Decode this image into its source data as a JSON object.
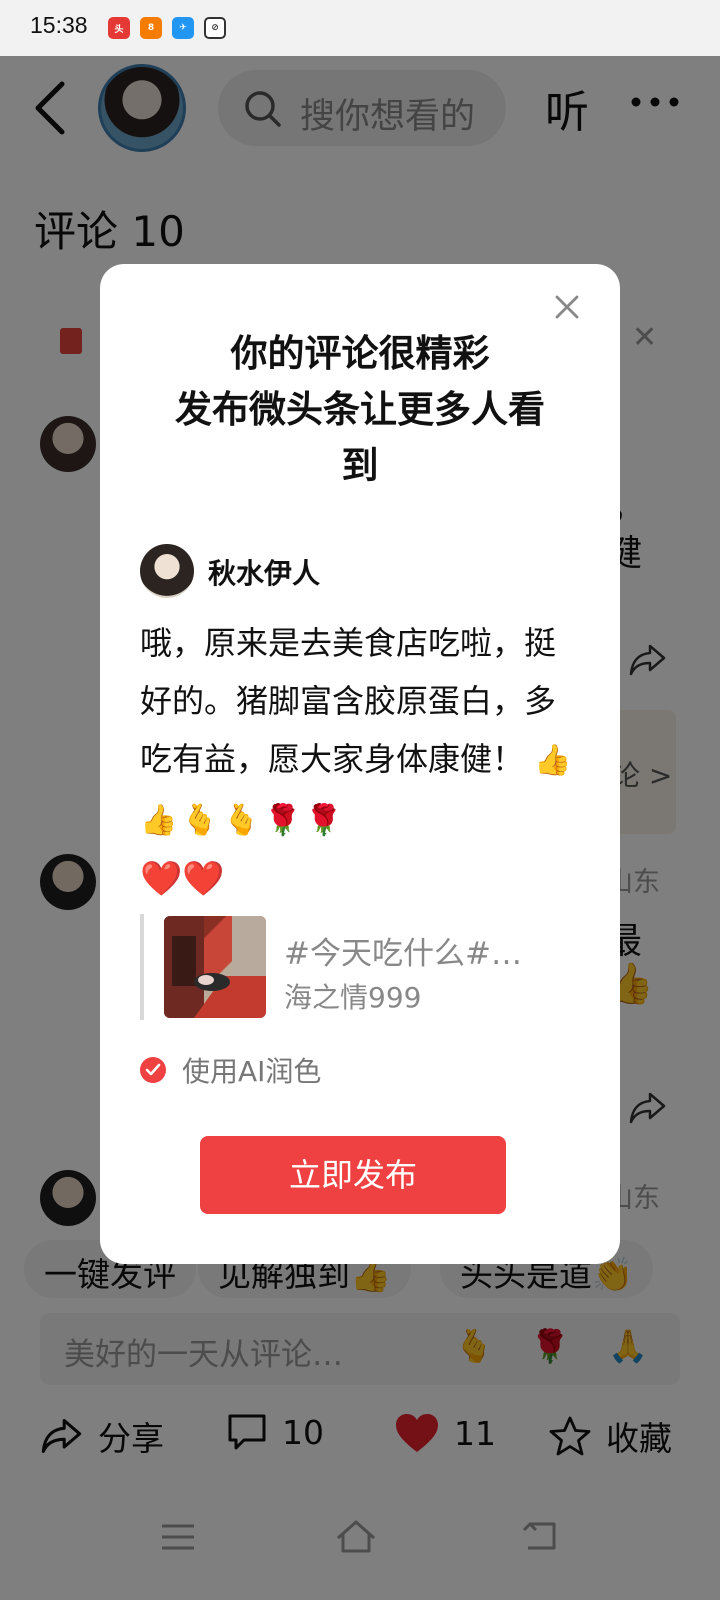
{
  "status_bar": {
    "time": "15:38",
    "icons": [
      "toutiao-app-icon",
      "notification-app-icon",
      "telegram-icon",
      "browser-icon"
    ]
  },
  "header": {
    "search_placeholder": "搜你想看的",
    "listen_label": "听"
  },
  "comments_section": {
    "title": "评论 10",
    "background_fragments": {
      "text_1": "，",
      "text_2": "健",
      "text_3": "最",
      "location_1": "山东",
      "location_2": "山东",
      "card_arrow": "论 >"
    },
    "quick_replies": [
      "一键发评",
      "见解独到👍",
      "头头是道👏"
    ],
    "input_placeholder": "美好的一天从评论…",
    "input_emojis": [
      "🫰",
      "🌹",
      "🙏"
    ]
  },
  "action_bar": {
    "share_label": "分享",
    "comment_count": "10",
    "like_count": "11",
    "favorite_label": "收藏"
  },
  "modal": {
    "title_line1": "你的评论很精彩",
    "title_line2": "发布微头条让更多人看",
    "title_line3": "到",
    "username": "秋水伊人",
    "comment_text": "哦，原来是去美食店吃啦，挺好的。猪脚富含胶原蛋白，多吃有益，愿大家身体康健！",
    "comment_emojis": "👍👍🫰🫰🌹🌹",
    "comment_hearts": "❤️❤️",
    "quote_title": "#今天吃什么#…",
    "quote_author": "海之情999",
    "ai_polish_label": "使用AI润色",
    "ai_polish_checked": true,
    "publish_label": "立即发布"
  },
  "colors": {
    "accent_red": "#f04142",
    "overlay": "rgba(0,0,0,0.5)"
  }
}
